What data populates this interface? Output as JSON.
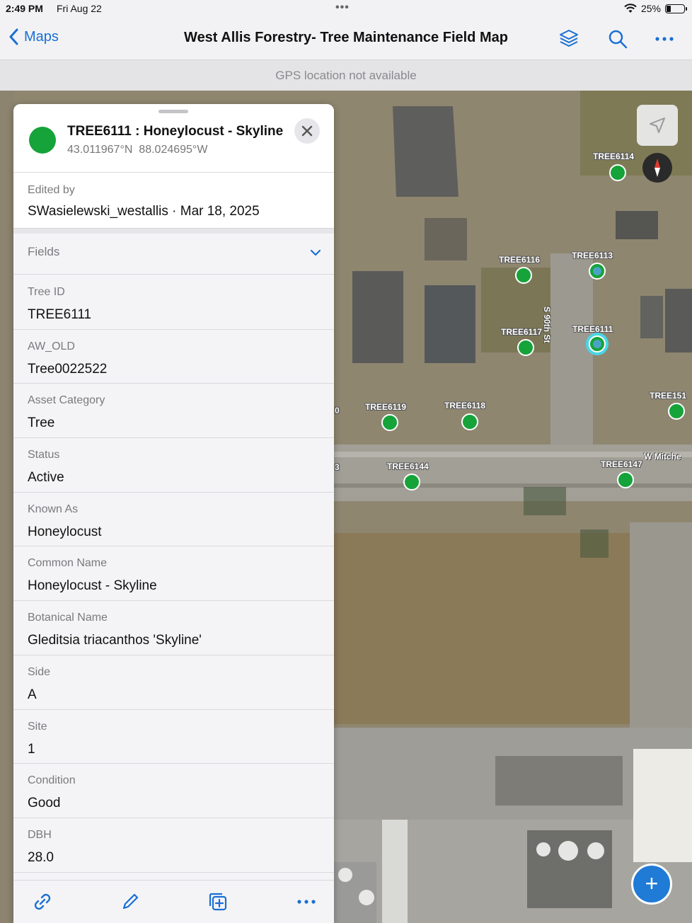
{
  "status_bar": {
    "time": "2:49 PM",
    "date": "Fri Aug 22",
    "battery": "25%",
    "battery_level": 0.25
  },
  "nav": {
    "back_label": "Maps",
    "title": "West Allis Forestry- Tree Maintenance Field Map",
    "icons": [
      "layers-icon",
      "search-icon",
      "more-icon"
    ]
  },
  "gps_banner": "GPS location not available",
  "feature": {
    "title": "TREE6111 : Honeylocust - Skyline",
    "lat": "43.011967°N",
    "lon": "88.024695°W",
    "symbol_color": "#16a33a",
    "edited_by_label": "Edited by",
    "edited_by_value": "SWasielewski_westallis · Mar 18, 2025",
    "fields_header": "Fields",
    "fields": [
      {
        "label": "Tree ID",
        "value": "TREE6111"
      },
      {
        "label": "AW_OLD",
        "value": "Tree0022522"
      },
      {
        "label": "Asset Category",
        "value": "Tree"
      },
      {
        "label": "Status",
        "value": "Active"
      },
      {
        "label": "Known As",
        "value": "Honeylocust"
      },
      {
        "label": "Common Name",
        "value": "Honeylocust - Skyline"
      },
      {
        "label": "Botanical Name",
        "value": "Gleditsia triacanthos 'Skyline'"
      },
      {
        "label": "Side",
        "value": "A"
      },
      {
        "label": "Site",
        "value": "1"
      },
      {
        "label": "Condition",
        "value": "Good"
      },
      {
        "label": "DBH",
        "value": "28.0"
      }
    ],
    "toolbar": [
      "link-icon",
      "edit-pencil-icon",
      "duplicate-icon",
      "more-icon"
    ]
  },
  "map": {
    "markers": [
      {
        "label": "TREE6114"
      },
      {
        "label": "TREE6116"
      },
      {
        "label": "TREE6113"
      },
      {
        "label": "TREE6117"
      },
      {
        "label": "TREE6111"
      },
      {
        "label": "TREE6119"
      },
      {
        "label": "TREE6118"
      },
      {
        "label": "TREE6144"
      },
      {
        "label": "TREE6147"
      },
      {
        "label": "TREE151"
      }
    ],
    "street_labels": [
      "S 90th St",
      "W Mitche"
    ],
    "edge_labels": [
      "0",
      "3"
    ],
    "marker_color": "#16a33a",
    "selection_color": "#49d6e6",
    "fab_label": "+"
  }
}
